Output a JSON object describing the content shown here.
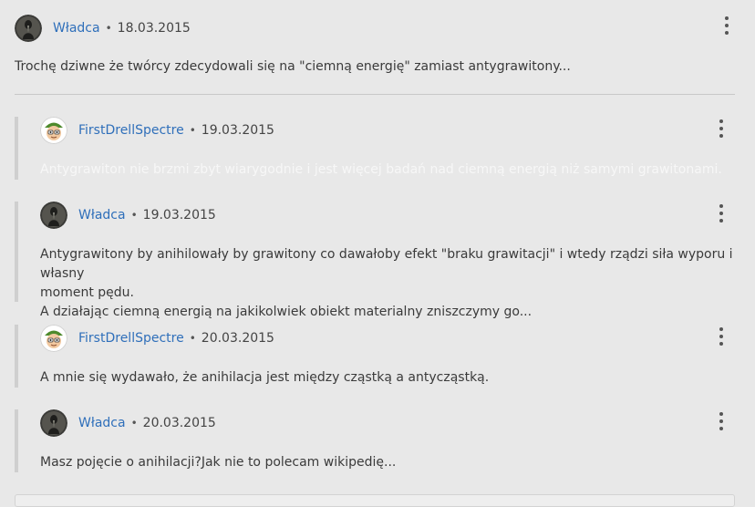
{
  "thread": {
    "top_comment": {
      "username": "Władca",
      "date": "18.03.2015",
      "text": "Trochę dziwne że twórcy zdecydowali się na \"ciemną energię\" zamiast antygrawitony..."
    },
    "replies": [
      {
        "username": "FirstDrellSpectre",
        "date": "19.03.2015",
        "lines": [
          "Antygrawiton nie brzmi zbyt wiarygodnie i jest więcej badań nad ciemną energią niż samymi grawitonami."
        ]
      },
      {
        "username": "Władca",
        "date": "19.03.2015",
        "lines": [
          "Antygrawitony by anihilowały by grawitony co dawałoby efekt \"braku grawitacji\" i wtedy rządzi siła wyporu i własny",
          "moment pędu.",
          "A działając ciemną energią na jakikolwiek obiekt materialny  zniszczymy go..."
        ]
      },
      {
        "username": "FirstDrellSpectre",
        "date": "20.03.2015",
        "lines": [
          "A mnie się wydawało, że anihilacja jest między cząstką a antycząstką."
        ]
      },
      {
        "username": "Władca",
        "date": "20.03.2015",
        "lines": [
          "Masz pojęcie o anihilacji?Jak nie to polecam wikipedię..."
        ]
      }
    ]
  },
  "separator": "•",
  "icons": {
    "menu": "more-vertical-icon",
    "avatar_dark": "dark-figure-avatar",
    "avatar_face": "green-cap-face-avatar"
  },
  "colors": {
    "background": "#e8e8e8",
    "username": "#2f6fba",
    "text": "#3a3a3a"
  }
}
